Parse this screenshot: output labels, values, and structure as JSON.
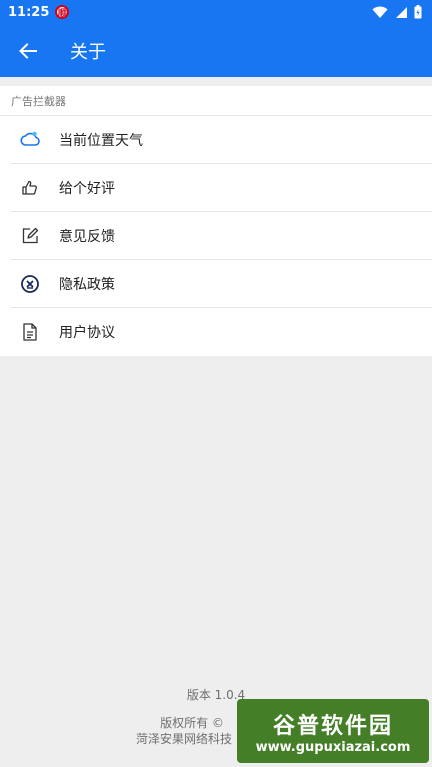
{
  "status_bar": {
    "time": "11:25",
    "notification_badge": "顺"
  },
  "app_bar": {
    "title": "关于"
  },
  "section": {
    "header": "广告拦截器"
  },
  "menu": [
    {
      "label": "当前位置天气",
      "icon": "weather-cloud-icon"
    },
    {
      "label": "给个好评",
      "icon": "thumbs-up-icon"
    },
    {
      "label": "意见反馈",
      "icon": "edit-feedback-icon"
    },
    {
      "label": "隐私政策",
      "icon": "privacy-icon"
    },
    {
      "label": "用户协议",
      "icon": "document-icon"
    }
  ],
  "footer": {
    "version": "版本 1.0.4",
    "copyright": "版权所有 ©",
    "company": "菏泽安果网络科技"
  },
  "watermark": {
    "title": "谷普软件园",
    "url": "www.gupuxiazai.com"
  },
  "colors": {
    "primary": "#1976f2",
    "background": "#eeeeee"
  }
}
